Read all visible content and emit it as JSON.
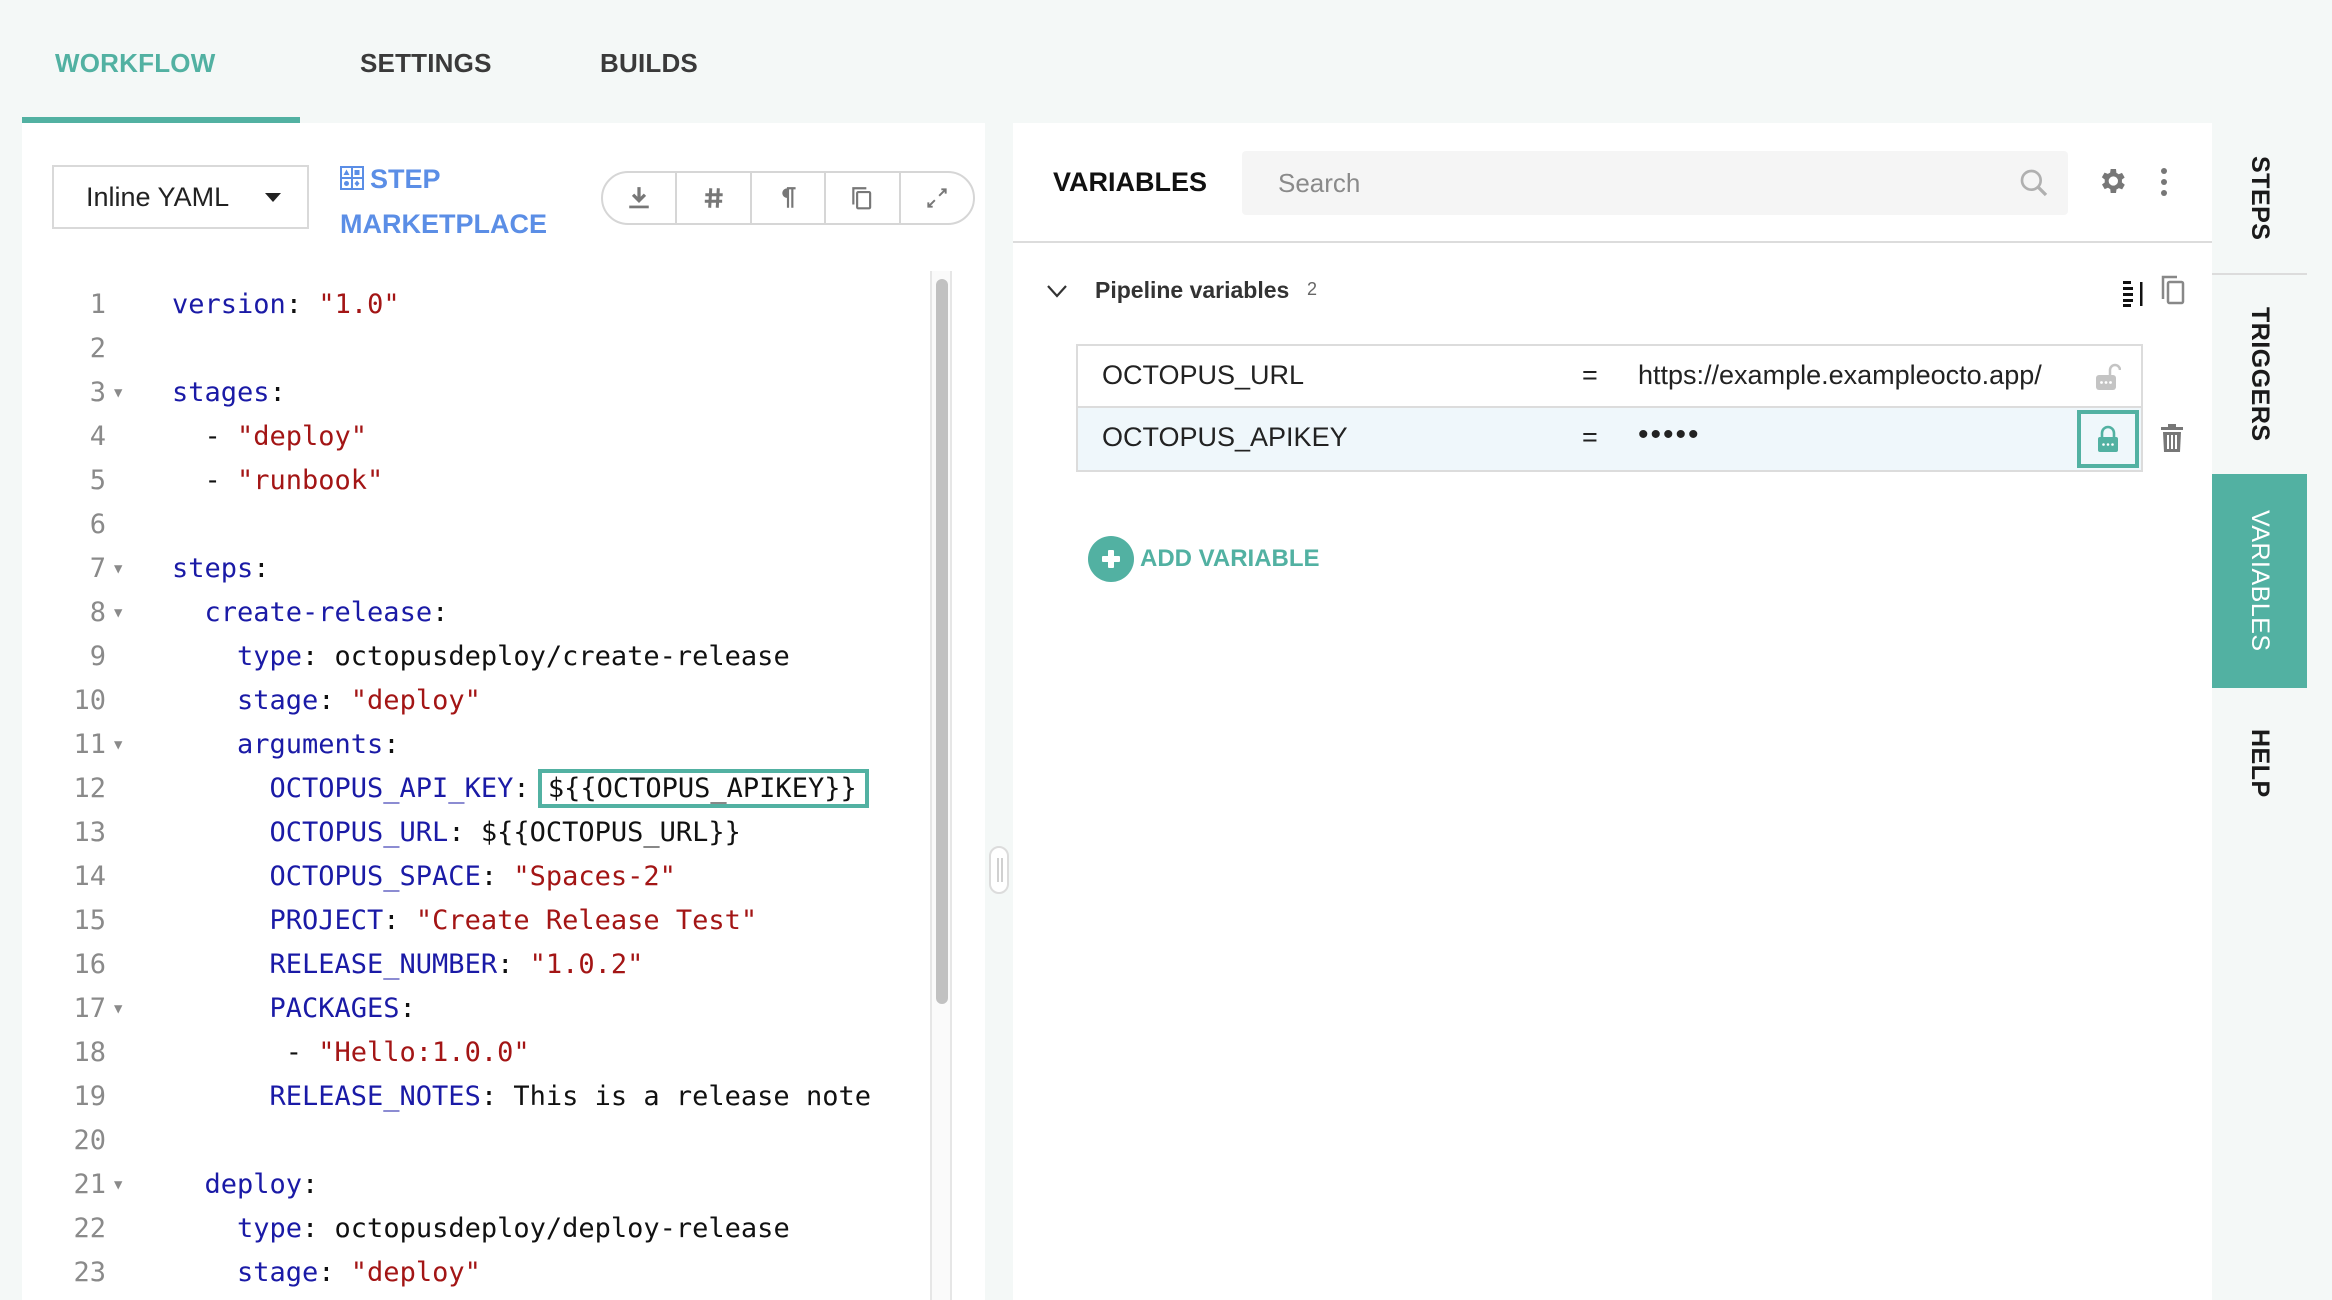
{
  "top_tabs": [
    {
      "label": "WORKFLOW",
      "active": true
    },
    {
      "label": "SETTINGS",
      "active": false
    },
    {
      "label": "BUILDS",
      "active": false
    }
  ],
  "editor": {
    "mode_select": {
      "value": "Inline YAML",
      "icon": "caret-down-icon"
    },
    "marketplace": {
      "line1": "STEP",
      "line2": "MARKETPLACE",
      "icon": "grid-icon"
    },
    "toolbar": [
      {
        "name": "download",
        "icon": "download-icon"
      },
      {
        "name": "line-numbers",
        "icon": "hash-icon"
      },
      {
        "name": "show-whitespace",
        "icon": "pilcrow-icon"
      },
      {
        "name": "copy",
        "icon": "copy-icon"
      },
      {
        "name": "expand",
        "icon": "expand-icon"
      }
    ],
    "lines": [
      {
        "n": "1",
        "fold": false,
        "indent": 0,
        "key": "version",
        "sep": ": ",
        "value": "\"1.0\"",
        "vtype": "s"
      },
      {
        "n": "2",
        "fold": false,
        "indent": 0,
        "key": "",
        "sep": "",
        "value": "",
        "vtype": "p"
      },
      {
        "n": "3",
        "fold": true,
        "indent": 0,
        "key": "stages",
        "sep": ":",
        "value": "",
        "vtype": "p"
      },
      {
        "n": "4",
        "fold": false,
        "indent": 2,
        "key": "",
        "sep": "- ",
        "value": "\"deploy\"",
        "vtype": "s"
      },
      {
        "n": "5",
        "fold": false,
        "indent": 2,
        "key": "",
        "sep": "- ",
        "value": "\"runbook\"",
        "vtype": "s"
      },
      {
        "n": "6",
        "fold": false,
        "indent": 0,
        "key": "",
        "sep": "",
        "value": "",
        "vtype": "p"
      },
      {
        "n": "7",
        "fold": true,
        "indent": 0,
        "key": "steps",
        "sep": ":",
        "value": "",
        "vtype": "p"
      },
      {
        "n": "8",
        "fold": true,
        "indent": 2,
        "key": "create-release",
        "sep": ":",
        "value": "",
        "vtype": "p"
      },
      {
        "n": "9",
        "fold": false,
        "indent": 4,
        "key": "type",
        "sep": ": ",
        "value": "octopusdeploy/create-release",
        "vtype": "p"
      },
      {
        "n": "10",
        "fold": false,
        "indent": 4,
        "key": "stage",
        "sep": ": ",
        "value": "\"deploy\"",
        "vtype": "s"
      },
      {
        "n": "11",
        "fold": true,
        "indent": 4,
        "key": "arguments",
        "sep": ":",
        "value": "",
        "vtype": "p"
      },
      {
        "n": "12",
        "fold": false,
        "indent": 6,
        "key": "OCTOPUS_API_KEY",
        "sep": ": ",
        "value": "${{OCTOPUS_APIKEY}}",
        "vtype": "p",
        "highlight": true
      },
      {
        "n": "13",
        "fold": false,
        "indent": 6,
        "key": "OCTOPUS_URL",
        "sep": ": ",
        "value": "${{OCTOPUS_URL}}",
        "vtype": "p"
      },
      {
        "n": "14",
        "fold": false,
        "indent": 6,
        "key": "OCTOPUS_SPACE",
        "sep": ": ",
        "value": "\"Spaces-2\"",
        "vtype": "s"
      },
      {
        "n": "15",
        "fold": false,
        "indent": 6,
        "key": "PROJECT",
        "sep": ": ",
        "value": "\"Create Release Test\"",
        "vtype": "s"
      },
      {
        "n": "16",
        "fold": false,
        "indent": 6,
        "key": "RELEASE_NUMBER",
        "sep": ": ",
        "value": "\"1.0.2\"",
        "vtype": "s"
      },
      {
        "n": "17",
        "fold": true,
        "indent": 6,
        "key": "PACKAGES",
        "sep": ":",
        "value": "",
        "vtype": "p"
      },
      {
        "n": "18",
        "fold": false,
        "indent": 7,
        "key": "",
        "sep": "- ",
        "value": "\"Hello:1.0.0\"",
        "vtype": "s"
      },
      {
        "n": "19",
        "fold": false,
        "indent": 6,
        "key": "RELEASE_NOTES",
        "sep": ": ",
        "value": "This is a release note",
        "vtype": "p"
      },
      {
        "n": "20",
        "fold": false,
        "indent": 0,
        "key": "",
        "sep": "",
        "value": "",
        "vtype": "p"
      },
      {
        "n": "21",
        "fold": true,
        "indent": 2,
        "key": "deploy",
        "sep": ":",
        "value": "",
        "vtype": "p"
      },
      {
        "n": "22",
        "fold": false,
        "indent": 4,
        "key": "type",
        "sep": ": ",
        "value": "octopusdeploy/deploy-release",
        "vtype": "p"
      },
      {
        "n": "23",
        "fold": false,
        "indent": 4,
        "key": "stage",
        "sep": ": ",
        "value": "\"deploy\"",
        "vtype": "s"
      }
    ]
  },
  "variables_panel": {
    "title": "VARIABLES",
    "search": {
      "placeholder": "Search",
      "value": ""
    },
    "group": {
      "title": "Pipeline variables",
      "count": "2",
      "expanded": true
    },
    "rows": [
      {
        "name": "OCTOPUS_URL",
        "eq": "=",
        "value": "https://example.exampleocto.app/",
        "secret": false,
        "selected": false
      },
      {
        "name": "OCTOPUS_APIKEY",
        "eq": "=",
        "value": "•••••",
        "secret": true,
        "selected": true
      }
    ],
    "add_label": "ADD VARIABLE"
  },
  "side_tabs": [
    {
      "label": "STEPS",
      "active": false
    },
    {
      "label": "TRIGGERS",
      "active": false
    },
    {
      "label": "VARIABLES",
      "active": true
    },
    {
      "label": "HELP",
      "active": false
    }
  ],
  "colors": {
    "accent": "#52b1a2",
    "link": "#5b8ee6",
    "yaml_key": "#1a1aa6",
    "yaml_string": "#a31515",
    "selected_row": "#eff7fb"
  }
}
